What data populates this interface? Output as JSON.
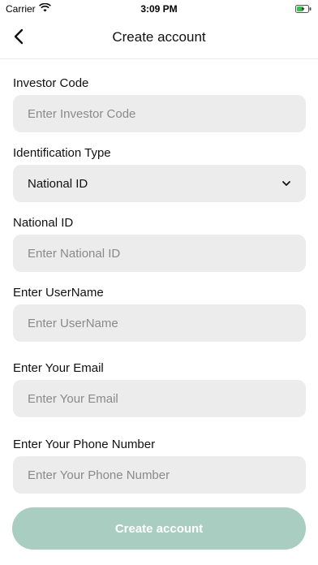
{
  "status_bar": {
    "carrier": "Carrier",
    "time": "3:09 PM",
    "icons": [
      "wifi-icon",
      "battery-charging-icon"
    ]
  },
  "header": {
    "title": "Create account",
    "back_icon": "chevron-left-icon"
  },
  "form": {
    "investor_code": {
      "label": "Investor Code",
      "placeholder": "Enter Investor Code",
      "value": ""
    },
    "identification_type": {
      "label": "Identification Type",
      "selected": "National ID",
      "icon": "chevron-down-icon"
    },
    "national_id": {
      "label": "National ID",
      "placeholder": "Enter National ID",
      "value": ""
    },
    "username": {
      "label": "Enter UserName",
      "placeholder": "Enter UserName",
      "value": ""
    },
    "email": {
      "label": "Enter Your Email",
      "placeholder": "Enter Your Email",
      "value": ""
    },
    "phone": {
      "label": "Enter Your Phone Number",
      "placeholder": "Enter Your Phone Number",
      "value": ""
    }
  },
  "submit": {
    "label": "Create account"
  },
  "colors": {
    "input_background": "#ececec",
    "button_background": "#aacdc1",
    "button_text": "#ffffff",
    "placeholder_text": "#8a8a8a"
  }
}
